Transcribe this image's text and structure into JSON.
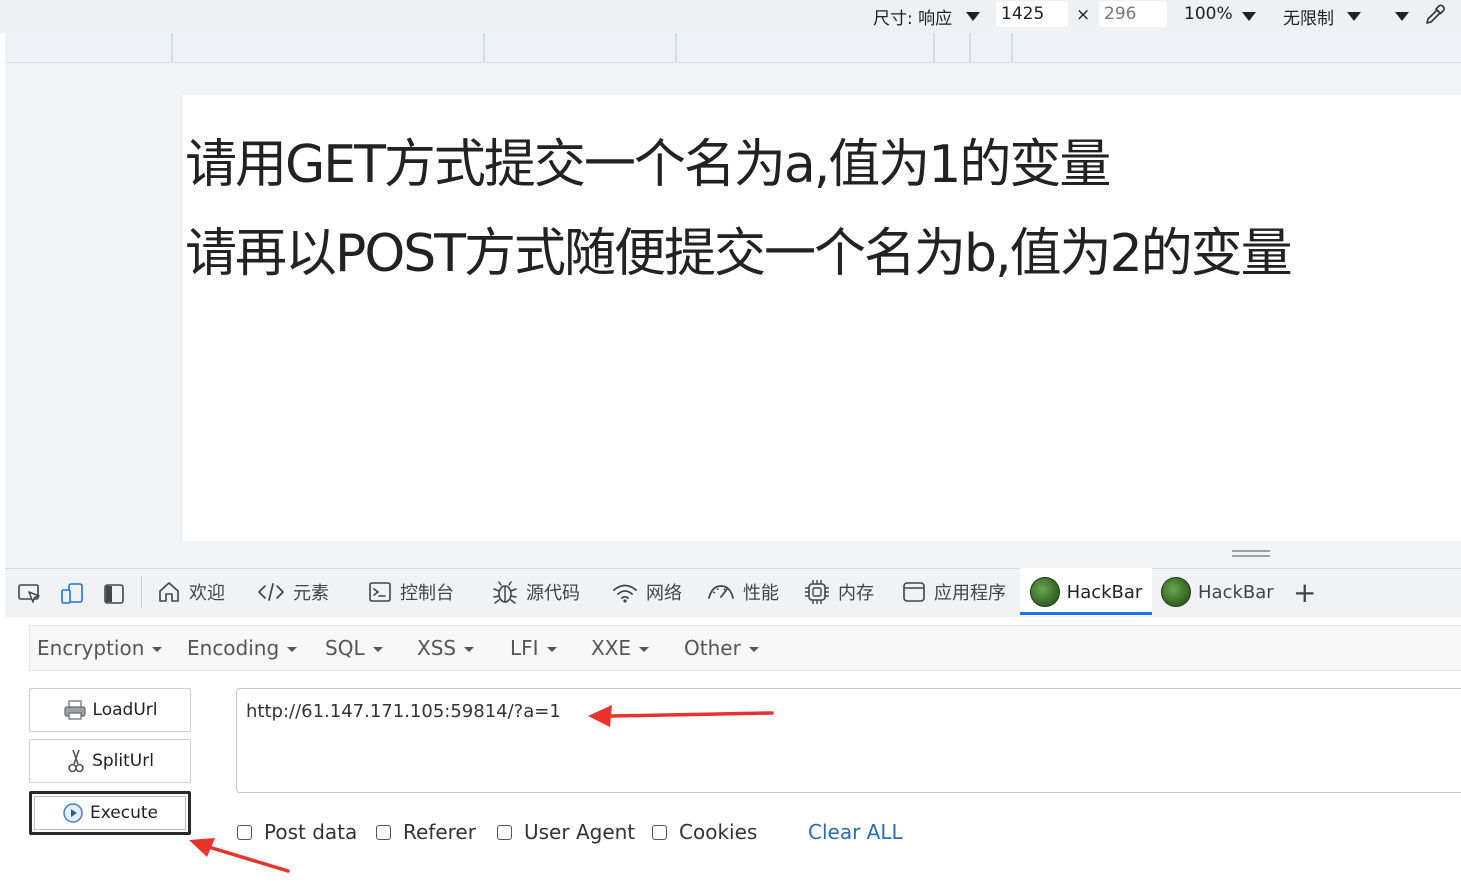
{
  "device_toolbar": {
    "dimensions_label": "尺寸: 响应",
    "width_value": "1425",
    "times_symbol": "×",
    "height_value": "296",
    "zoom": "100%",
    "throttle": "无限制"
  },
  "page": {
    "line1": "请用GET方式提交一个名为a,值为1的变量",
    "line2": "请再以POST方式随便提交一个名为b,值为2的变量"
  },
  "devtools": {
    "tabs": [
      {
        "label": "欢迎",
        "icon": "home-icon"
      },
      {
        "label": "元素",
        "icon": "code-icon"
      },
      {
        "label": "控制台",
        "icon": "console-icon"
      },
      {
        "label": "源代码",
        "icon": "bug-icon"
      },
      {
        "label": "网络",
        "icon": "wifi-icon"
      },
      {
        "label": "性能",
        "icon": "gauge-icon"
      },
      {
        "label": "内存",
        "icon": "chip-icon"
      },
      {
        "label": "应用程序",
        "icon": "window-icon"
      },
      {
        "label": "HackBar",
        "icon": "hackbar-logo-icon",
        "active": true
      },
      {
        "label": "HackBar",
        "icon": "hackbar-logo-icon"
      }
    ],
    "add_tab_symbol": "+"
  },
  "hackbar": {
    "menu": [
      "Encryption",
      "Encoding",
      "SQL",
      "XSS",
      "LFI",
      "XXE",
      "Other"
    ],
    "buttons": {
      "load": "LoadUrl",
      "split": "SplitUrl",
      "execute": "Execute"
    },
    "url": "http://61.147.171.105:59814/?a=1",
    "options": [
      "Post data",
      "Referer",
      "User Agent",
      "Cookies"
    ],
    "clear_all": "Clear ALL"
  },
  "colors": {
    "accent_blue": "#1a73e8",
    "link_blue": "#2a6db6",
    "annotation_red": "#e8322b"
  }
}
